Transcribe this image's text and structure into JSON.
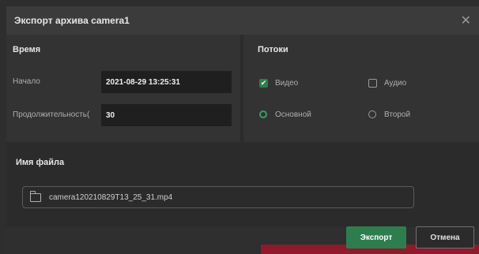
{
  "dialog": {
    "title": "Экспорт архива camera1",
    "close_icon": "close-icon"
  },
  "time": {
    "section_title": "Время",
    "start_label": "Начало",
    "start_value": "2021-08-29 13:25:31",
    "duration_label": "Продолжительность(",
    "duration_value": "30"
  },
  "streams": {
    "section_title": "Потоки",
    "video_label": "Видео",
    "video_checked": true,
    "audio_label": "Аудио",
    "audio_checked": false,
    "main_label": "Основной",
    "main_selected": true,
    "second_label": "Второй",
    "second_selected": false
  },
  "file": {
    "section_title": "Имя файла",
    "icon": "folder-icon",
    "filename": "camera120210829T13_25_31.mp4"
  },
  "buttons": {
    "export_label": "Экспорт",
    "cancel_label": "Отмена"
  },
  "colors": {
    "accent": "#2e7d4f",
    "background": "#2b2b2b",
    "panel": "#333333"
  }
}
